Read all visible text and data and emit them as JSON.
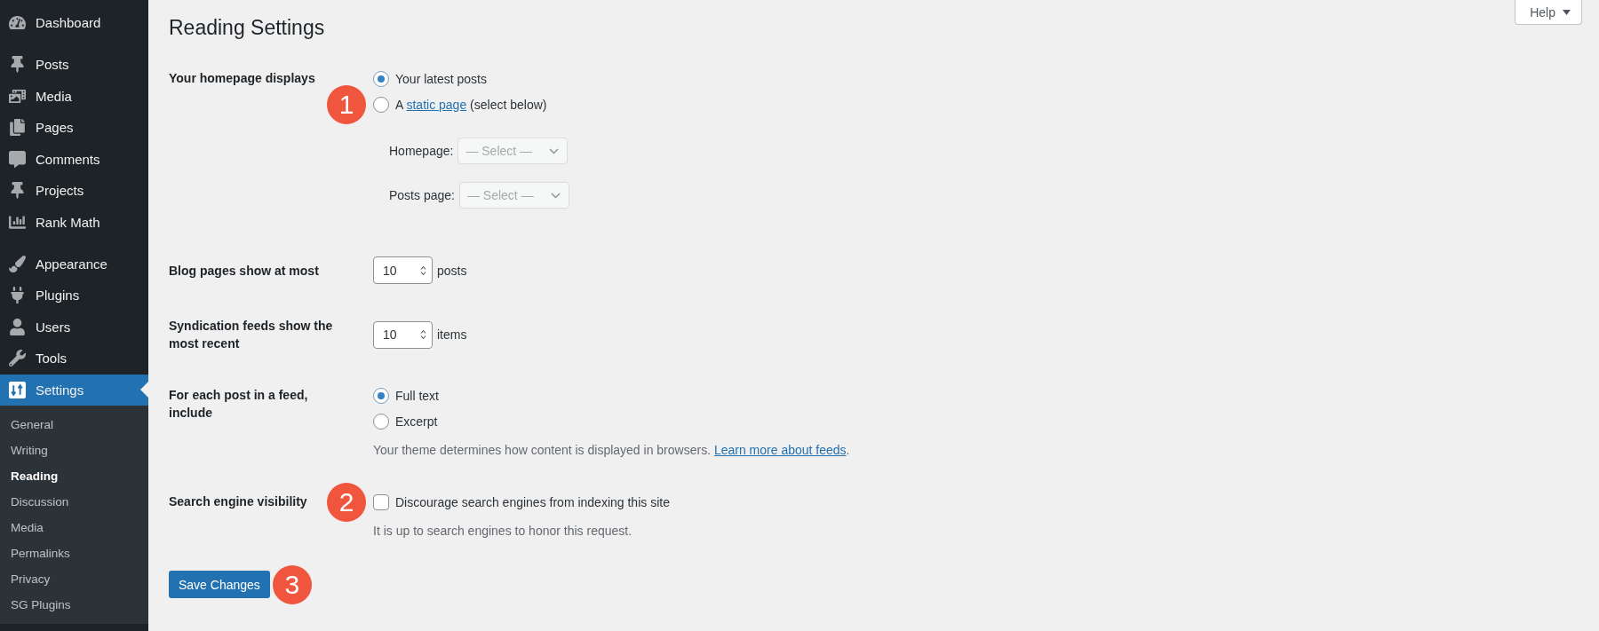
{
  "sidebar": {
    "groups": [
      {
        "items": [
          {
            "label": "Dashboard",
            "selected": false
          }
        ]
      },
      {
        "items": [
          {
            "label": "Posts",
            "selected": false
          },
          {
            "label": "Media",
            "selected": false
          },
          {
            "label": "Pages",
            "selected": false
          },
          {
            "label": "Comments",
            "selected": false
          },
          {
            "label": "Projects",
            "selected": false
          },
          {
            "label": "Rank Math",
            "selected": false
          }
        ]
      },
      {
        "items": [
          {
            "label": "Appearance",
            "selected": false
          },
          {
            "label": "Plugins",
            "selected": false
          },
          {
            "label": "Users",
            "selected": false
          },
          {
            "label": "Tools",
            "selected": false
          },
          {
            "label": "Settings",
            "selected": true,
            "submenu": [
              {
                "label": "General",
                "selected": false
              },
              {
                "label": "Writing",
                "selected": false
              },
              {
                "label": "Reading",
                "selected": true
              },
              {
                "label": "Discussion",
                "selected": false
              },
              {
                "label": "Media",
                "selected": false
              },
              {
                "label": "Permalinks",
                "selected": false
              },
              {
                "label": "Privacy",
                "selected": false
              },
              {
                "label": "SG Plugins",
                "selected": false
              }
            ]
          }
        ]
      }
    ]
  },
  "help_button": {
    "label": "Help"
  },
  "page_title": "Reading Settings",
  "settings": [
    {
      "kind": "radio_group",
      "label": "Your homepage displays",
      "options": [
        {
          "text": "Your latest posts",
          "selected": true
        },
        {
          "text": "A",
          "link": "static page",
          "text_after": "(select below)",
          "selected": false,
          "callout": "1"
        }
      ],
      "selects": [
        {
          "label": "Homepage:",
          "value": "— Select —",
          "disabled": true
        },
        {
          "label": "Posts page:",
          "value": "— Select —",
          "disabled": true
        }
      ]
    },
    {
      "kind": "number",
      "label": "Blog pages show at most",
      "value": "10",
      "unit": "posts"
    },
    {
      "kind": "number",
      "label": "Syndication feeds show the most recent",
      "value": "10",
      "unit": "items"
    },
    {
      "kind": "radio_group",
      "label": "For each post in a feed, include",
      "options": [
        {
          "text": "Full text",
          "selected": true
        },
        {
          "text": "Excerpt",
          "selected": false
        }
      ],
      "description": {
        "text": "Your theme determines how content is displayed in browsers.",
        "link": "Learn more about feeds",
        "text_after": "."
      }
    },
    {
      "kind": "checkbox",
      "label": "Search engine visibility",
      "option": {
        "text": "Discourage search engines from indexing this site",
        "checked": false,
        "callout": "2"
      },
      "description": {
        "text": "It is up to search engines to honor this request."
      }
    }
  ],
  "save_button": {
    "label": "Save Changes",
    "callout": "3"
  }
}
